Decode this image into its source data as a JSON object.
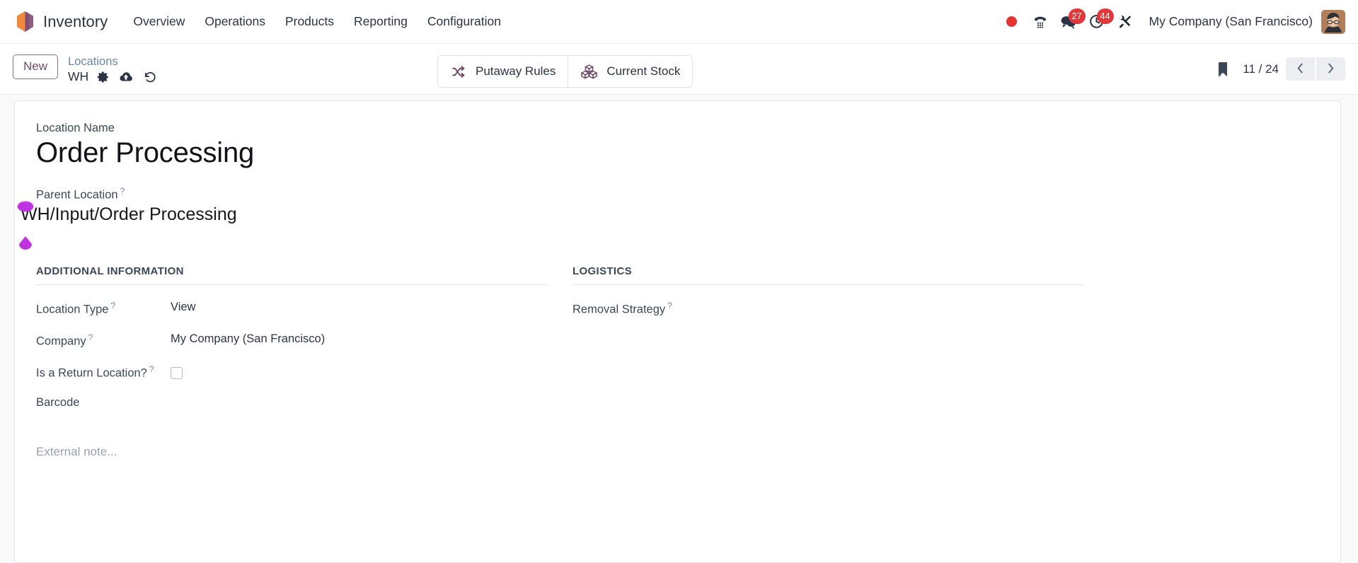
{
  "navbar": {
    "brand": "Inventory",
    "menu": [
      {
        "label": "Overview"
      },
      {
        "label": "Operations"
      },
      {
        "label": "Products"
      },
      {
        "label": "Reporting"
      },
      {
        "label": "Configuration"
      }
    ],
    "icons": {
      "recording": "record-dot-icon",
      "phone": "phone-dialpad-icon",
      "messages": "messages-icon",
      "activities": "activity-clock-icon",
      "tools": "tools-icon"
    },
    "messages_count": "27",
    "activities_count": "44",
    "company": "My Company (San Francisco)",
    "avatar": "user-avatar"
  },
  "control_panel": {
    "new_label": "New",
    "breadcrumb_parent": "Locations",
    "breadcrumb_current": "WH",
    "icons": {
      "settings": "gear-icon",
      "save": "cloud-upload-icon",
      "discard": "undo-icon",
      "bookmark": "bookmark-icon",
      "prev": "chevron-left-icon",
      "next": "chevron-right-icon"
    },
    "stat_buttons": [
      {
        "label": "Putaway Rules",
        "icon": "shuffle-icon"
      },
      {
        "label": "Current Stock",
        "icon": "boxes-icon"
      }
    ],
    "pager": "11 / 24"
  },
  "form": {
    "name_label": "Location Name",
    "name_value": "Order Processing",
    "parent_label": "Parent Location",
    "parent_value": "WH/Input/Order Processing",
    "help_mark": "?",
    "groups": [
      {
        "title": "ADDITIONAL INFORMATION",
        "rows": [
          {
            "label": "Location Type",
            "help": true,
            "value": "View",
            "type": "text"
          },
          {
            "label": "Company",
            "help": true,
            "value": "My Company (San Francisco)",
            "type": "text"
          },
          {
            "label": "Is a Return Location?",
            "help": true,
            "value": "",
            "type": "checkbox",
            "checked": false
          },
          {
            "label": "Barcode",
            "help": false,
            "value": "",
            "type": "text"
          }
        ]
      },
      {
        "title": "LOGISTICS",
        "rows": [
          {
            "label": "Removal Strategy",
            "help": true,
            "value": "",
            "type": "text"
          }
        ]
      }
    ],
    "note_placeholder": "External note..."
  },
  "colors": {
    "brand_primary": "#714b67",
    "badge_red": "#e0383b",
    "link_blue": "#6b87a8",
    "marker_purple": "#c034e0"
  }
}
